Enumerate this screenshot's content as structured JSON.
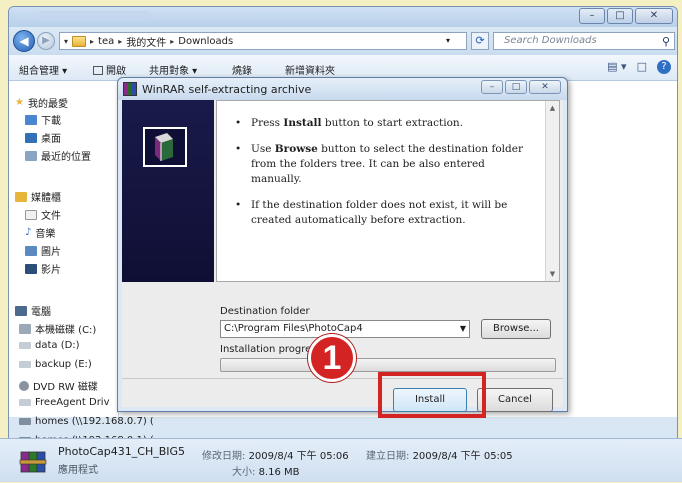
{
  "address": {
    "crumbs": [
      "tea",
      "我的文件",
      "Downloads"
    ],
    "search_placeholder": "Search Downloads"
  },
  "toolbar": {
    "organize": "組合管理 ▾",
    "open": "開啟",
    "share": "共用對象 ▾",
    "burn": "燒錄",
    "new_folder": "新增資料夾"
  },
  "sidebar": {
    "items": [
      {
        "label": "我的最愛",
        "icon": "star-icon"
      },
      {
        "label": "下載",
        "icon": "download-folder-icon"
      },
      {
        "label": "桌面",
        "icon": "desktop-icon"
      },
      {
        "label": "最近的位置",
        "icon": "recent-places-icon"
      },
      {
        "label": "媒體櫃",
        "icon": "library-icon"
      },
      {
        "label": "文件",
        "icon": "documents-icon"
      },
      {
        "label": "音樂",
        "icon": "music-icon"
      },
      {
        "label": "圖片",
        "icon": "pictures-icon"
      },
      {
        "label": "影片",
        "icon": "videos-icon"
      },
      {
        "label": "電腦",
        "icon": "computer-icon"
      },
      {
        "label": "本機磁碟 (C:)",
        "icon": "local-disk-icon"
      },
      {
        "label": "data (D:)",
        "icon": "drive-icon"
      },
      {
        "label": "backup (E:)",
        "icon": "drive-icon"
      },
      {
        "label": "DVD RW 磁碟",
        "icon": "dvd-drive-icon"
      },
      {
        "label": "FreeAgent Driv",
        "icon": "drive-icon"
      },
      {
        "label": "homes (\\\\192.168.0.7) (",
        "icon": "network-drive-icon"
      },
      {
        "label": "homes (\\\\192.168.0.1) (",
        "icon": "network-drive-icon"
      }
    ]
  },
  "details": {
    "filename": "PhotoCap431_CH_BIG5",
    "modified_label": "修改日期:",
    "modified_value": "2009/8/4 下午 05:06",
    "created_label": "建立日期:",
    "created_value": "2009/8/4 下午 05:05",
    "type": "應用程式",
    "size_label": "大小:",
    "size_value": "8.16 MB"
  },
  "dialog": {
    "title": "WinRAR self-extracting archive",
    "bullet1_pre": "Press ",
    "bullet1_bold": "Install",
    "bullet1_post": " button to start extraction.",
    "bullet2_pre": "Use ",
    "bullet2_bold": "Browse",
    "bullet2_post": " button to select the destination folder from the folders tree. It can be also entered manually.",
    "bullet3": "If the destination folder does not exist, it will be created automatically before extraction.",
    "dest_label": "Destination folder",
    "dest_value": "C:\\Program Files\\PhotoCap4",
    "browse_label": "Browse...",
    "progress_label": "Installation progress",
    "progress_fraction": 0,
    "install_label": "Install",
    "cancel_label": "Cancel"
  },
  "annotation": {
    "step_number": "1",
    "highlight_color": "#d42323"
  }
}
